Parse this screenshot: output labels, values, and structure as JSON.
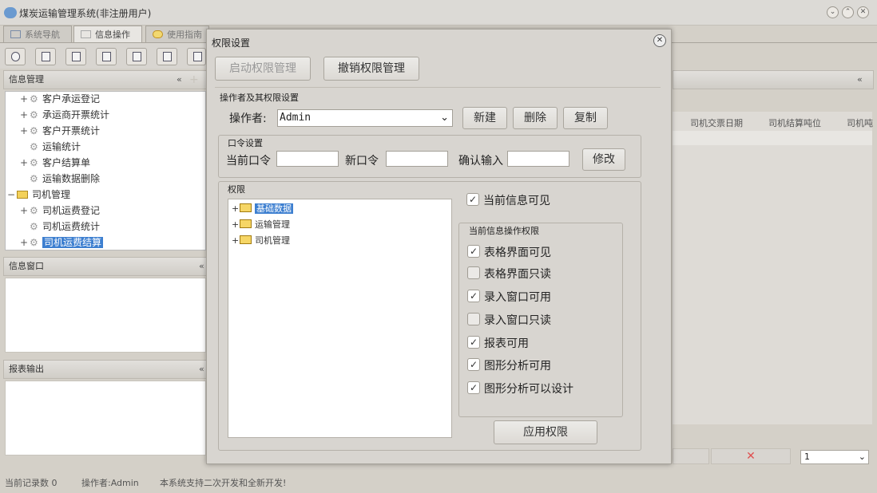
{
  "app": {
    "title": "煤炭运输管理系统(非注册用户)",
    "tabs": [
      "系统导航",
      "信息操作",
      "使用指南"
    ]
  },
  "left": {
    "info_panel_title": "信息管理",
    "tree": [
      {
        "label": "客户承运登记",
        "expander": "+"
      },
      {
        "label": "承运商开票统计",
        "expander": "+"
      },
      {
        "label": "客户开票统计",
        "expander": "+"
      },
      {
        "label": "运输统计",
        "expander": ""
      },
      {
        "label": "客户结算单",
        "expander": "+"
      },
      {
        "label": "运输数据删除",
        "expander": ""
      },
      {
        "label": "司机管理",
        "expander": "−"
      },
      {
        "label": "司机运费登记",
        "expander": "+"
      },
      {
        "label": "司机运费统计",
        "expander": ""
      },
      {
        "label": "司机运费结算",
        "expander": "+"
      }
    ],
    "window_panel_title": "信息窗口",
    "report_panel_title": "报表输出"
  },
  "right": {
    "columns": [
      "司机交票日期",
      "司机结算吨位",
      "司机吨"
    ],
    "page_select_value": "1",
    "delete_mark": "✕"
  },
  "status": {
    "record_count": "当前记录数 0",
    "operator": "操作者:Admin",
    "message": "本系统支持二次开发和全新开发!"
  },
  "dialog": {
    "title": "权限设置",
    "close_glyph": "✕",
    "enable_button": "启动权限管理",
    "revoke_button": "撤销权限管理",
    "operator_group": "操作者及其权限设置",
    "operator_label": "操作者:",
    "operator_value": "Admin",
    "new_button": "新建",
    "delete_button": "删除",
    "copy_button": "复制",
    "password_group": "口令设置",
    "current_pwd_label": "当前口令",
    "new_pwd_label": "新口令",
    "confirm_label": "确认输入",
    "modify_button": "修改",
    "permission_group": "权限",
    "perm_tree": [
      "基础数据",
      "运输管理",
      "司机管理"
    ],
    "info_visible": {
      "label": "当前信息可见",
      "checked": true
    },
    "ops_group": "当前信息操作权限",
    "ops": [
      {
        "label": "表格界面可见",
        "checked": true
      },
      {
        "label": "表格界面只读",
        "checked": false
      },
      {
        "label": "录入窗口可用",
        "checked": true
      },
      {
        "label": "录入窗口只读",
        "checked": false
      },
      {
        "label": "报表可用",
        "checked": true
      },
      {
        "label": "图形分析可用",
        "checked": true
      },
      {
        "label": "图形分析可以设计",
        "checked": true
      }
    ],
    "apply_button": "应用权限"
  },
  "icons": [
    "app-icon",
    "minimize-icon",
    "restore-icon",
    "close-icon",
    "folder-icon",
    "gear-icon",
    "checkmark-icon"
  ]
}
